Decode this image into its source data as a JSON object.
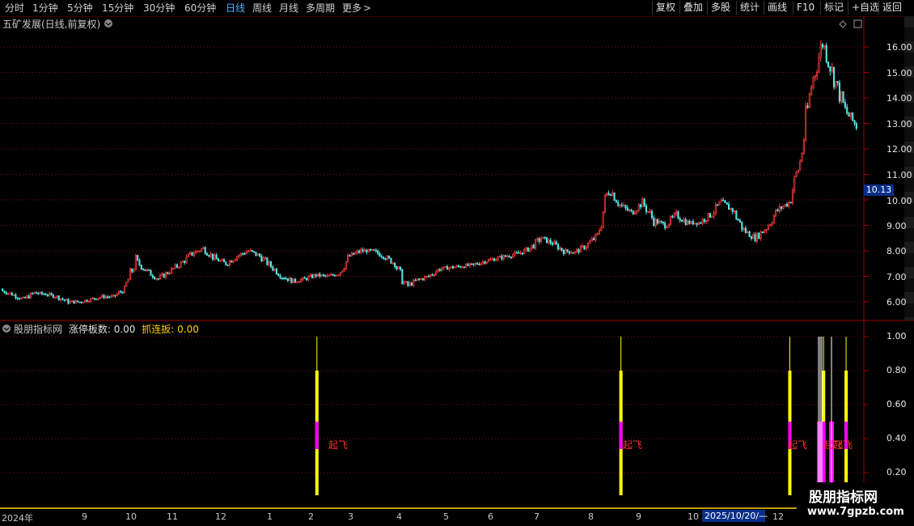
{
  "toolbar": {
    "periods": [
      {
        "label": "分时"
      },
      {
        "label": "1分钟"
      },
      {
        "label": "5分钟"
      },
      {
        "label": "15分钟"
      },
      {
        "label": "30分钟"
      },
      {
        "label": "60分钟"
      },
      {
        "label": "日线"
      },
      {
        "label": "周线"
      },
      {
        "label": "月线"
      },
      {
        "label": "多周期"
      },
      {
        "label": "更多"
      }
    ],
    "more_arrow": ">",
    "active_period": "日线",
    "right_buttons": [
      {
        "label": "复权"
      },
      {
        "label": "叠加"
      },
      {
        "label": "多股"
      },
      {
        "label": "统计"
      },
      {
        "label": "画线"
      },
      {
        "label": "F10"
      },
      {
        "label": "标记"
      },
      {
        "label": "+自选"
      },
      {
        "label": "返回"
      }
    ]
  },
  "price_panel": {
    "title": "五矿发展(日线,前复权)",
    "last_price": "10.13",
    "y_ticks": [
      "16.00",
      "15.00",
      "14.00",
      "13.00",
      "12.00",
      "11.00",
      "10.00",
      "9.00",
      "8.00",
      "7.00",
      "6.00"
    ],
    "y_values": [
      16,
      15,
      14,
      13,
      12,
      11,
      10,
      9,
      8,
      7,
      6
    ]
  },
  "indicator_panel": {
    "name": "股朋指标网",
    "series1_label": "涨停板数:",
    "series1_value": "0.00",
    "series2_label": "抓连扳:",
    "series2_value": "0.00",
    "y_ticks": [
      "1.00",
      "0.80",
      "0.60",
      "0.40",
      "0.20"
    ],
    "signal_text": "起飞"
  },
  "date_axis": {
    "labels": [
      {
        "text": "2024年"
      },
      {
        "text": "9"
      },
      {
        "text": "10"
      },
      {
        "text": "11"
      },
      {
        "text": "12"
      },
      {
        "text": "1"
      },
      {
        "text": "2"
      },
      {
        "text": "3"
      },
      {
        "text": "4"
      },
      {
        "text": "5"
      },
      {
        "text": "6"
      },
      {
        "text": "7"
      },
      {
        "text": "8"
      },
      {
        "text": "9"
      },
      {
        "text": "10"
      },
      {
        "text": "12"
      }
    ],
    "cursor_date": "2025/10/20/—"
  },
  "watermark": {
    "title": "股朋指标网",
    "url": "www.7gpzb.com"
  },
  "colors": {
    "up": "#ff3b3b",
    "down": "#54e3e3",
    "grid": "#7a1010",
    "axis": "#8b0000",
    "signal_yellow": "#ffff00",
    "signal_magenta": "#ff00ff"
  },
  "chart_data": {
    "type": "candlestick",
    "title": "五矿发展(日线,前复权)",
    "ylim": [
      5.6,
      16.8
    ],
    "price_path": [
      [
        6.5,
        6.45
      ],
      [
        6.4,
        6.3
      ],
      [
        6.2,
        6.1
      ],
      [
        6.2,
        6.35
      ],
      [
        6.4,
        6.3
      ],
      [
        6.25,
        6.2
      ],
      [
        6.1,
        6.0
      ],
      [
        5.95,
        6.0
      ],
      [
        6.05,
        6.1
      ],
      [
        6.15,
        6.2
      ],
      [
        6.1,
        6.2
      ],
      [
        6.3,
        6.5
      ],
      [
        7.0,
        7.6
      ],
      [
        7.5,
        7.2
      ],
      [
        7.1,
        6.9
      ],
      [
        7.0,
        7.2
      ],
      [
        7.3,
        7.5
      ],
      [
        7.6,
        7.9
      ],
      [
        8.0,
        8.1
      ],
      [
        7.9,
        7.7
      ],
      [
        7.6,
        7.5
      ],
      [
        7.6,
        7.8
      ],
      [
        7.9,
        8.0
      ],
      [
        8.0,
        7.8
      ],
      [
        7.6,
        7.4
      ],
      [
        7.2,
        7.0
      ],
      [
        6.9,
        6.8
      ],
      [
        6.8,
        6.9
      ],
      [
        7.0,
        7.05
      ],
      [
        7.1,
        7.0
      ],
      [
        7.05,
        7.1
      ],
      [
        7.2,
        7.8
      ],
      [
        7.9,
        8.0
      ],
      [
        7.95,
        8.0
      ],
      [
        7.9,
        7.8
      ],
      [
        7.7,
        7.5
      ],
      [
        7.2,
        6.6
      ],
      [
        6.6,
        6.85
      ],
      [
        6.9,
        7.0
      ],
      [
        7.1,
        7.3
      ],
      [
        7.3,
        7.35
      ],
      [
        7.3,
        7.4
      ],
      [
        7.4,
        7.45
      ],
      [
        7.5,
        7.6
      ],
      [
        7.6,
        7.7
      ],
      [
        7.7,
        7.8
      ],
      [
        7.8,
        7.9
      ],
      [
        7.9,
        8.1
      ],
      [
        8.2,
        8.5
      ],
      [
        8.5,
        8.3
      ],
      [
        8.2,
        8.0
      ],
      [
        8.0,
        7.95
      ],
      [
        8.1,
        8.2
      ],
      [
        8.4,
        8.6
      ],
      [
        9.5,
        10.5
      ],
      [
        10.3,
        9.8
      ],
      [
        9.6,
        9.5
      ],
      [
        9.7,
        9.9
      ],
      [
        9.6,
        9.2
      ],
      [
        8.9,
        9.0
      ],
      [
        9.2,
        9.4
      ],
      [
        9.3,
        9.1
      ],
      [
        9.0,
        9.1
      ],
      [
        9.3,
        9.4
      ],
      [
        9.6,
        9.9
      ],
      [
        10.0,
        9.6
      ],
      [
        9.2,
        8.8
      ],
      [
        8.6,
        8.5
      ],
      [
        8.6,
        8.9
      ],
      [
        9.2,
        9.6
      ],
      [
        9.7,
        9.9
      ],
      [
        10.2,
        11.5
      ],
      [
        12.5,
        14.5
      ],
      [
        15.0,
        16.2
      ],
      [
        15.6,
        14.8
      ],
      [
        14.2,
        13.5
      ],
      [
        13.4,
        12.9
      ]
    ],
    "indicator_signals": [
      {
        "date_index": 28,
        "value": 1.0
      },
      {
        "date_index": 55,
        "value": 1.0
      },
      {
        "date_index": 70,
        "value": 1.0
      },
      {
        "date_index": 73,
        "value": 1.0
      },
      {
        "date_index": 75,
        "value": 1.0
      }
    ]
  }
}
